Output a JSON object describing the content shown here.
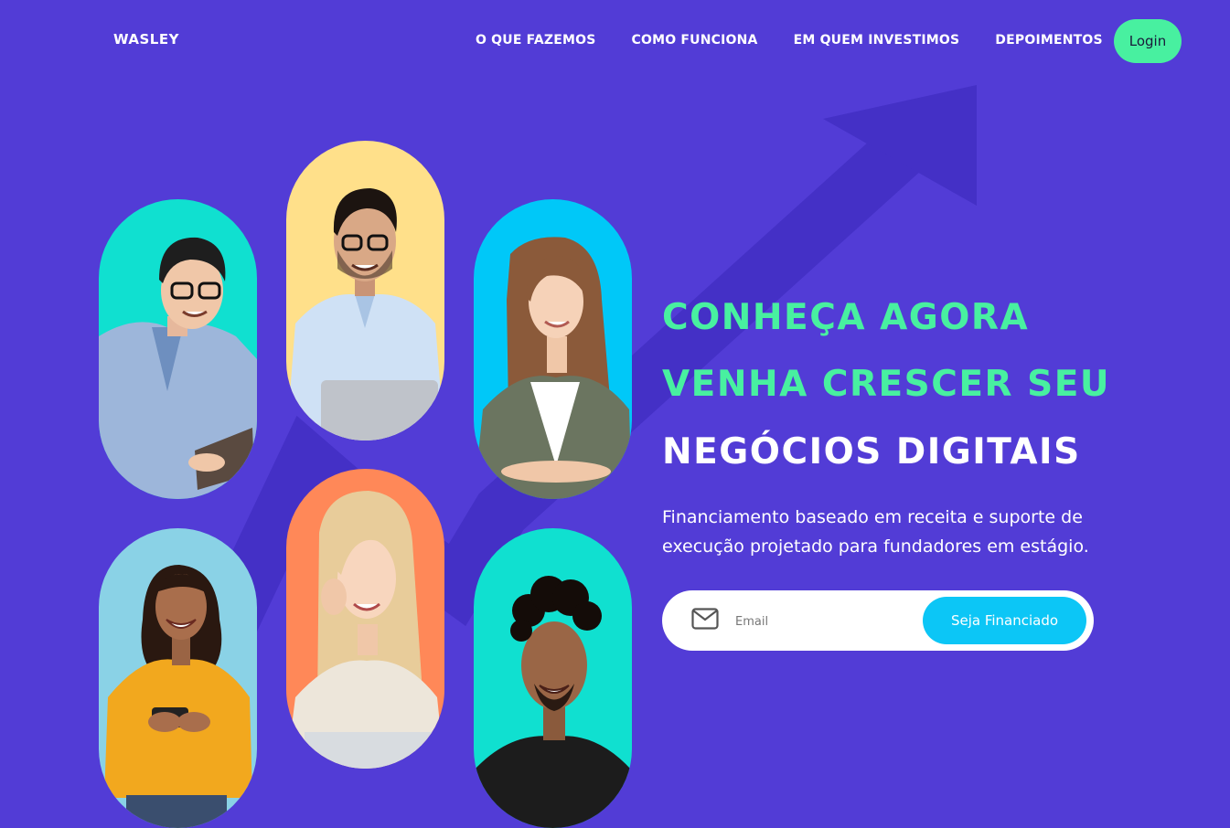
{
  "brand": {
    "logo": "WASLEY"
  },
  "nav": {
    "items": [
      {
        "label": "O QUE FAZEMOS"
      },
      {
        "label": "COMO FUNCIONA"
      },
      {
        "label": "EM QUEM INVESTIMOS"
      },
      {
        "label": "DEPOIMENTOS"
      }
    ],
    "login_label": "Login"
  },
  "hero": {
    "line1": "CONHEÇA AGORA",
    "line2": "VENHA CRESCER SEU",
    "line3": "NEGÓCIOS DIGITAIS",
    "subtitle": "Financiamento baseado em receita e suporte de execução projetado para fundadores em estágio.",
    "email_placeholder": "Email",
    "cta_label": "Seja Financiado"
  },
  "colors": {
    "background": "#523CD6",
    "arrow": "#4430C6",
    "accent_green": "#48F0A0",
    "accent_blue": "#0CC6F6",
    "text": "#FFFFFF"
  },
  "icons": {
    "mail": "mail-icon",
    "arrow": "growth-arrow"
  },
  "people": [
    {
      "name": "person-man-glasses-tablet",
      "bg": "#10E0D0"
    },
    {
      "name": "person-man-laptop",
      "bg": "#FFE08A"
    },
    {
      "name": "person-woman-jacket",
      "bg": "#00C8F8"
    },
    {
      "name": "person-woman-phone",
      "bg": "#8AD2E6"
    },
    {
      "name": "person-woman-blonde",
      "bg": "#FF8858"
    },
    {
      "name": "person-man-curly",
      "bg": "#10E0D0"
    }
  ]
}
